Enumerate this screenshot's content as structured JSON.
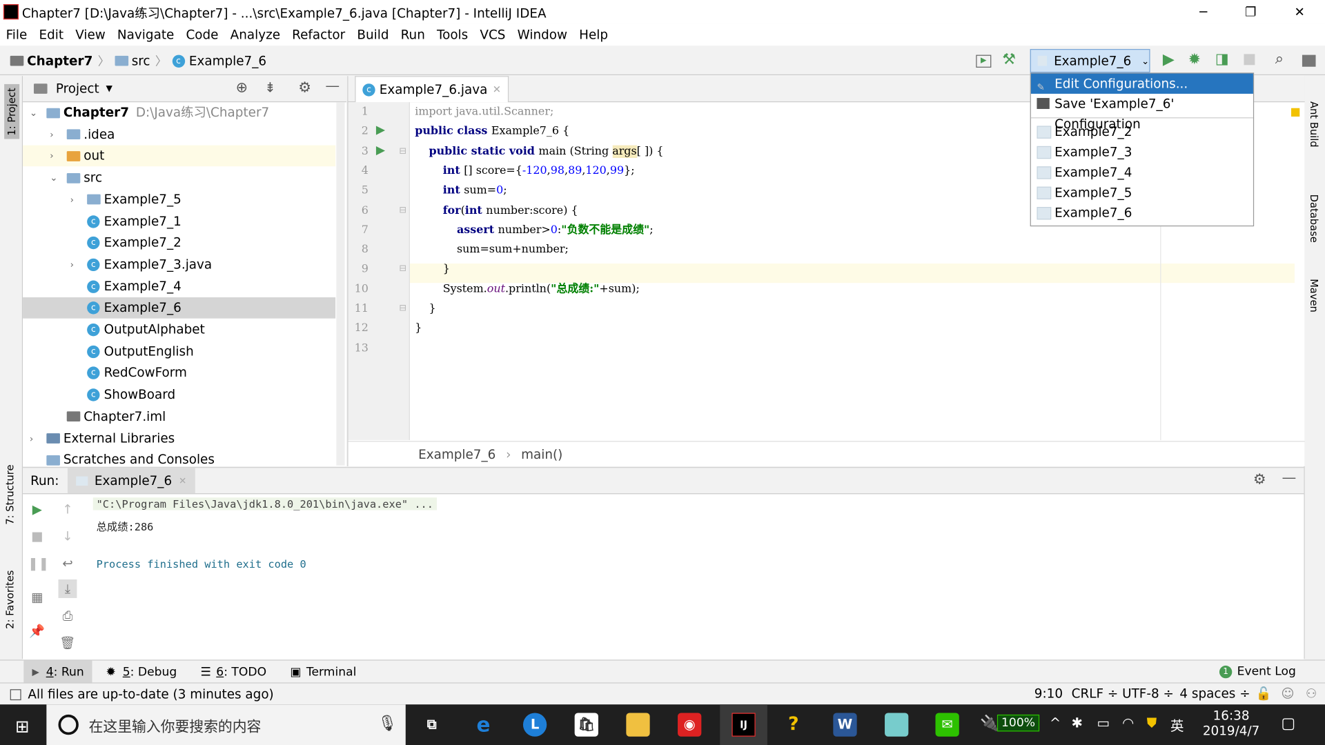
{
  "window": {
    "title": "Chapter7 [D:\\Java练习\\Chapter7] - ...\\src\\Example7_6.java [Chapter7] - IntelliJ IDEA",
    "minimize": "─",
    "restore": "❐",
    "close": "✕"
  },
  "menu": [
    "File",
    "Edit",
    "View",
    "Navigate",
    "Code",
    "Analyze",
    "Refactor",
    "Build",
    "Run",
    "Tools",
    "VCS",
    "Window",
    "Help"
  ],
  "breadcrumb": [
    "Chapter7",
    "src",
    "Example7_6"
  ],
  "run_config": {
    "selected": "Example7_6"
  },
  "config_popup": {
    "edit": "Edit Configurations...",
    "save": "Save 'Example7_6' Configuration",
    "items": [
      "Example7_2",
      "Example7_3",
      "Example7_4",
      "Example7_5",
      "Example7_6"
    ]
  },
  "left_strip": {
    "project": "1: Project",
    "structure": "7: Structure",
    "favorites": "2: Favorites"
  },
  "right_strip": {
    "ant": "Ant Build",
    "database": "Database",
    "maven": "Maven"
  },
  "project": {
    "title": "Project",
    "tree": [
      {
        "label": "Chapter7",
        "path": "D:\\Java练习\\Chapter7",
        "indent": 0,
        "arrow": "v",
        "icon": "folder",
        "bold": true
      },
      {
        "label": ".idea",
        "indent": 1,
        "arrow": ">",
        "icon": "folder"
      },
      {
        "label": "out",
        "indent": 1,
        "arrow": ">",
        "icon": "folder-orange"
      },
      {
        "label": "src",
        "indent": 1,
        "arrow": "v",
        "icon": "folder"
      },
      {
        "label": "Example7_5",
        "indent": 2,
        "arrow": ">",
        "icon": "package"
      },
      {
        "label": "Example7_1",
        "indent": 2,
        "icon": "class-run"
      },
      {
        "label": "Example7_2",
        "indent": 2,
        "icon": "class-run"
      },
      {
        "label": "Example7_3.java",
        "indent": 2,
        "arrow": ">",
        "icon": "class-run"
      },
      {
        "label": "Example7_4",
        "indent": 2,
        "icon": "class-run"
      },
      {
        "label": "Example7_6",
        "indent": 2,
        "icon": "class-run",
        "selected": true
      },
      {
        "label": "OutputAlphabet",
        "indent": 2,
        "icon": "class"
      },
      {
        "label": "OutputEnglish",
        "indent": 2,
        "icon": "class"
      },
      {
        "label": "RedCowForm",
        "indent": 2,
        "icon": "class"
      },
      {
        "label": "ShowBoard",
        "indent": 2,
        "icon": "class"
      },
      {
        "label": "Chapter7.iml",
        "indent": 1,
        "icon": "iml"
      },
      {
        "label": "External Libraries",
        "indent": 0,
        "arrow": ">",
        "icon": "library"
      },
      {
        "label": "Scratches and Consoles",
        "indent": 0,
        "icon": "scratch"
      }
    ]
  },
  "editor": {
    "tab": "Example7_6.java",
    "line_numbers": [
      "1",
      "2",
      "3",
      "4",
      "5",
      "6",
      "7",
      "8",
      "9",
      "10",
      "11",
      "12",
      "13"
    ],
    "code": [
      [
        [
          "gray",
          "import java.util.Scanner;"
        ]
      ],
      [
        [
          "kw",
          "public class "
        ],
        [
          "",
          "Example7_6 {"
        ]
      ],
      [
        [
          "",
          "    "
        ],
        [
          "kw",
          "public static void "
        ],
        [
          "",
          "main (String "
        ],
        [
          "",
          "args"
        ],
        [
          "",
          "[ ]) {"
        ]
      ],
      [
        [
          "",
          "        "
        ],
        [
          "kw",
          "int "
        ],
        [
          "",
          "[] score={"
        ],
        [
          "num",
          "-120"
        ],
        [
          "",
          ","
        ],
        [
          "num",
          "98"
        ],
        [
          "",
          ","
        ],
        [
          "num",
          "89"
        ],
        [
          "",
          ","
        ],
        [
          "num",
          "120"
        ],
        [
          "",
          ","
        ],
        [
          "num",
          "99"
        ],
        [
          "",
          "};"
        ]
      ],
      [
        [
          "",
          "        "
        ],
        [
          "kw",
          "int "
        ],
        [
          "",
          "sum="
        ],
        [
          "num",
          "0"
        ],
        [
          "",
          ";"
        ]
      ],
      [
        [
          "",
          "        "
        ],
        [
          "kw",
          "for"
        ],
        [
          "",
          "("
        ],
        [
          "kw",
          "int "
        ],
        [
          "",
          "number:score) {"
        ]
      ],
      [
        [
          "",
          "            "
        ],
        [
          "kw",
          "assert "
        ],
        [
          "",
          "number>"
        ],
        [
          "num",
          "0"
        ],
        [
          "",
          ":"
        ],
        [
          "str",
          "\"负数不能是成绩\""
        ],
        [
          "",
          ";"
        ]
      ],
      [
        [
          "",
          "            sum=sum+number;"
        ]
      ],
      [
        [
          "",
          "        }"
        ]
      ],
      [
        [
          "",
          "        System."
        ],
        [
          "ital",
          "out"
        ],
        [
          "",
          ".println("
        ],
        [
          "str",
          "\"总成绩:\""
        ],
        [
          "",
          "+sum);"
        ]
      ],
      [
        [
          "",
          "    }"
        ]
      ],
      [
        [
          "",
          "}"
        ]
      ],
      [
        [
          "",
          ""
        ]
      ]
    ],
    "breadcrumb": [
      "Example7_6",
      "main()"
    ]
  },
  "run": {
    "label": "Run:",
    "tab": "Example7_6",
    "output": [
      "\"C:\\Program Files\\Java\\jdk1.8.0_201\\bin\\java.exe\" ...",
      "总成绩:286",
      "",
      "Process finished with exit code 0"
    ]
  },
  "bottom_tabs": [
    {
      "num": "4",
      "label": ": Run"
    },
    {
      "num": "5",
      "label": ": Debug"
    },
    {
      "num": "6",
      "label": ": TODO"
    },
    {
      "num": "",
      "label": "Terminal"
    }
  ],
  "event_log": {
    "count": "1",
    "label": "Event Log"
  },
  "status": {
    "message": "All files are up-to-date (3 minutes ago)",
    "position": "9:10",
    "line_sep": "CRLF ÷",
    "encoding": "UTF-8 ÷",
    "indent": "4 spaces ÷"
  },
  "taskbar": {
    "search_placeholder": "在这里输入你要搜索的内容",
    "battery": "100%",
    "ime": "英",
    "time": "16:38",
    "date": "2019/4/7"
  },
  "colors": {
    "accent": "#2675bf",
    "run_green": "#499c54",
    "caret_line": "#fefbe6"
  }
}
